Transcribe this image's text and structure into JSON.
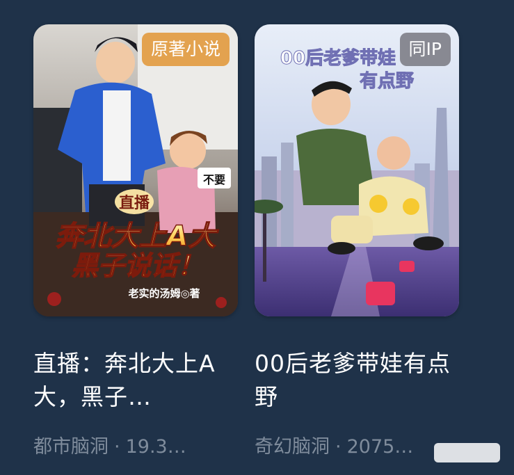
{
  "books": [
    {
      "badge": "原著小说",
      "cover": {
        "line_top": "直播",
        "line_main": "奔北大上A大",
        "line_second": "黑子说话！",
        "author": "老实的汤姆◎著",
        "bubble": "不要"
      },
      "title": "直播：奔北大上A大，黑子…",
      "category": "都市脑洞",
      "separator": "·",
      "stat": "19.3…"
    },
    {
      "badge": "同IP",
      "cover": {
        "title_line_1": "00后老爹带娃",
        "title_line_2": "有点野"
      },
      "title": "00后老爹带娃有点野",
      "category": "奇幻脑洞",
      "separator": "·",
      "stat": "2075…"
    }
  ]
}
